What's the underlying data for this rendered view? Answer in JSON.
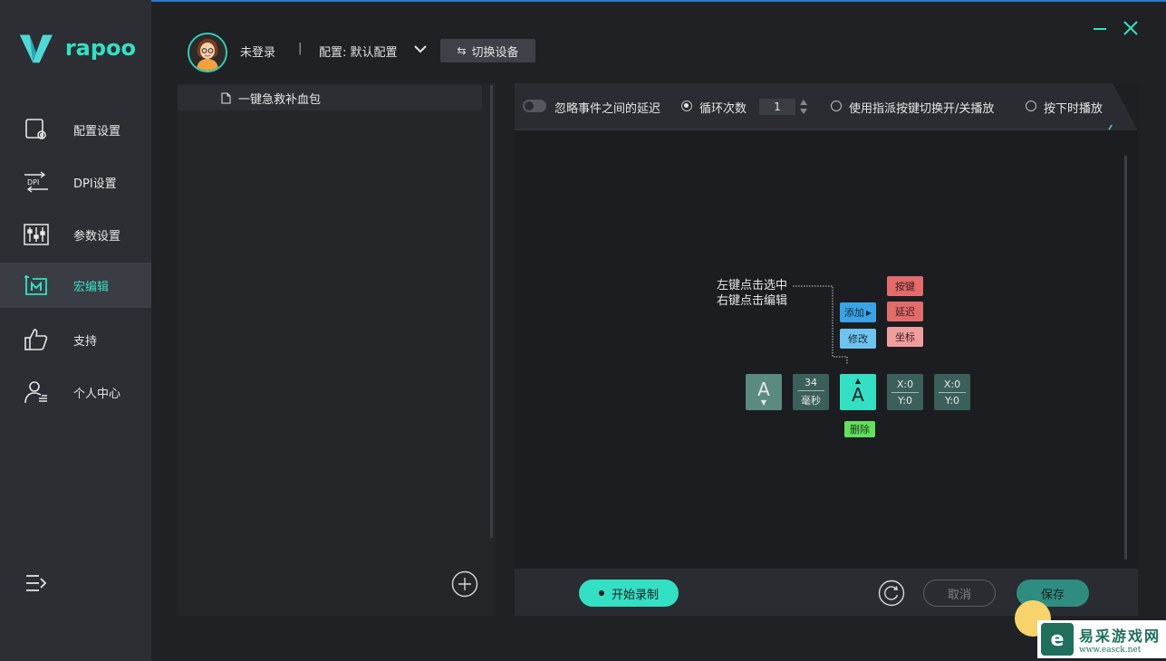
{
  "brand": {
    "logo_text": "rapoo"
  },
  "sidebar": {
    "items": [
      {
        "label": "配置设置",
        "icon": "config-settings-icon"
      },
      {
        "label": "DPI设置",
        "icon": "dpi-icon"
      },
      {
        "label": "参数设置",
        "icon": "parameter-sliders-icon"
      },
      {
        "label": "宏编辑",
        "icon": "macro-edit-icon",
        "active": true
      },
      {
        "label": "支持",
        "icon": "thumbs-up-icon"
      },
      {
        "label": "个人中心",
        "icon": "user-center-icon"
      }
    ]
  },
  "header": {
    "login_status": "未登录",
    "separator": "|",
    "config_label": "配置: 默认配置",
    "switch_device": "切换设备"
  },
  "macro_list": {
    "items": [
      {
        "name": "一键急救补血包"
      }
    ]
  },
  "toolbar": {
    "ignore_delay": "忽略事件之间的延迟",
    "loop_count_label": "循环次数",
    "loop_count_value": "1",
    "toggle_play_label": "使用指派按键切换开/关播放",
    "press_play_label": "按下时播放",
    "selected_mode": "loop_count"
  },
  "editor": {
    "hint_line1": "左键点击选中",
    "hint_line2": "右键点击编辑",
    "nodes": {
      "key1": "A",
      "delay_value": "34",
      "delay_unit": "毫秒",
      "key2": "A",
      "coord1_x": "X:0",
      "coord1_y": "Y:0",
      "coord2_x": "X:0",
      "coord2_y": "Y:0"
    },
    "context": {
      "add": "添加",
      "modify": "修改",
      "key": "按键",
      "delay": "延迟",
      "coord": "坐标",
      "delete": "删除"
    }
  },
  "bottom": {
    "record": "开始录制",
    "cancel": "取消",
    "save": "保存"
  },
  "watermark": {
    "title": "易采游戏网",
    "url": "www.easck.net"
  },
  "colors": {
    "accent": "#34e0c4",
    "sidebar_bg": "#2c2e33",
    "add_blue": "#3aa3e6",
    "delete_green": "#63e05e",
    "red": "#e26b6b"
  }
}
